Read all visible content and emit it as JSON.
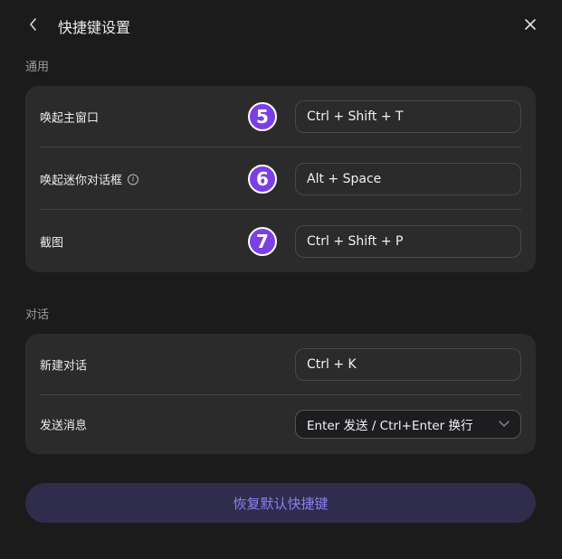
{
  "header": {
    "title": "快捷键设置",
    "back_icon": "chevron-left-icon",
    "close_icon": "close-icon"
  },
  "sections": {
    "general": {
      "label": "通用",
      "rows": [
        {
          "label": "唤起主窗口",
          "badge": "5",
          "value": "Ctrl + Shift + T"
        },
        {
          "label": "唤起迷你对话框",
          "badge": "6",
          "value": "Alt + Space",
          "info_icon": "info-icon"
        },
        {
          "label": "截图",
          "badge": "7",
          "value": "Ctrl + Shift + P"
        }
      ]
    },
    "dialog": {
      "label": "对话",
      "rows": [
        {
          "label": "新建对话",
          "value": "Ctrl + K"
        },
        {
          "label": "发送消息",
          "value": "Enter 发送 / Ctrl+Enter 换行",
          "dropdown_icon": "chevron-down-icon"
        }
      ]
    }
  },
  "reset_button": {
    "label": "恢复默认快捷键"
  },
  "colors": {
    "background": "#1b1b1c",
    "card": "#2b2b2c",
    "badge": "#7b3fe4",
    "accent_text": "#8b7ff5",
    "reset_bg": "#302c4c"
  }
}
